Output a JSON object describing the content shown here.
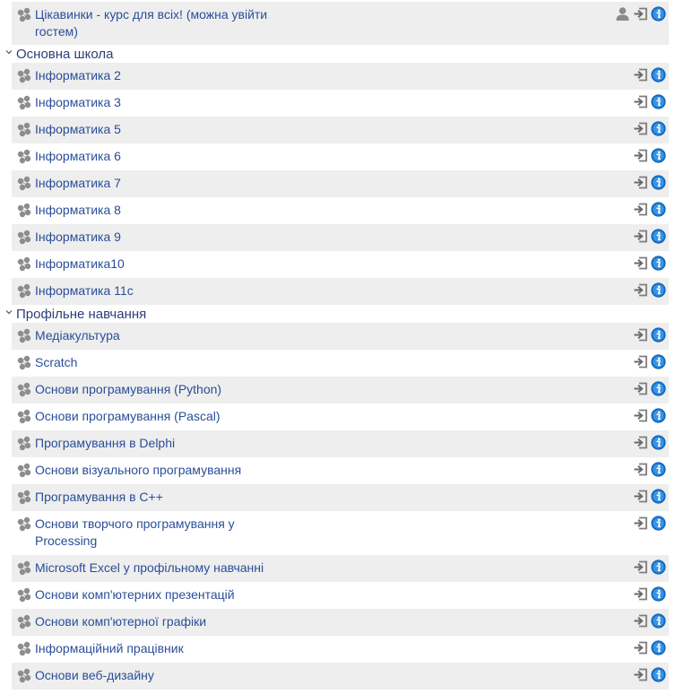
{
  "courses_top": [
    {
      "name": "Цікавинки - курс для всіх! (можна увійти гостем)",
      "guest": true
    }
  ],
  "categories": [
    {
      "title": "Основна школа",
      "courses": [
        {
          "name": "Інформатика 2"
        },
        {
          "name": "Інформатика 3"
        },
        {
          "name": "Інформатика 5"
        },
        {
          "name": "Інформатика 6"
        },
        {
          "name": "Інформатика 7"
        },
        {
          "name": "Інформатика 8"
        },
        {
          "name": "Інформатика 9"
        },
        {
          "name": "Інформатика10"
        },
        {
          "name": "Інформатика 11с"
        }
      ]
    },
    {
      "title": "Профільне навчання",
      "courses": [
        {
          "name": "Медіакультура"
        },
        {
          "name": "Scratch"
        },
        {
          "name": "Основи програмування (Python)"
        },
        {
          "name": "Основи програмування (Pascal)"
        },
        {
          "name": "Програмування в Delphi"
        },
        {
          "name": "Основи візуального програмування"
        },
        {
          "name": "Програмування в С++"
        },
        {
          "name": "Основи творчого програмування у Processing"
        },
        {
          "name": "Microsoft Excel у профільному навчанні"
        },
        {
          "name": "Основи комп'ютерних презентацій"
        },
        {
          "name": "Основи комп'ютерної графіки"
        },
        {
          "name": "Інформаційний працівник"
        },
        {
          "name": "Основи веб-дизайну"
        }
      ]
    }
  ],
  "icons": {
    "course": "course-icon",
    "guest": "guest-access-icon",
    "enrol": "self-enrol-icon",
    "info": "info-icon"
  },
  "colors": {
    "link": "#2a4e9a",
    "info": "#1a7ad4",
    "row_alt": "#eeeeee"
  }
}
